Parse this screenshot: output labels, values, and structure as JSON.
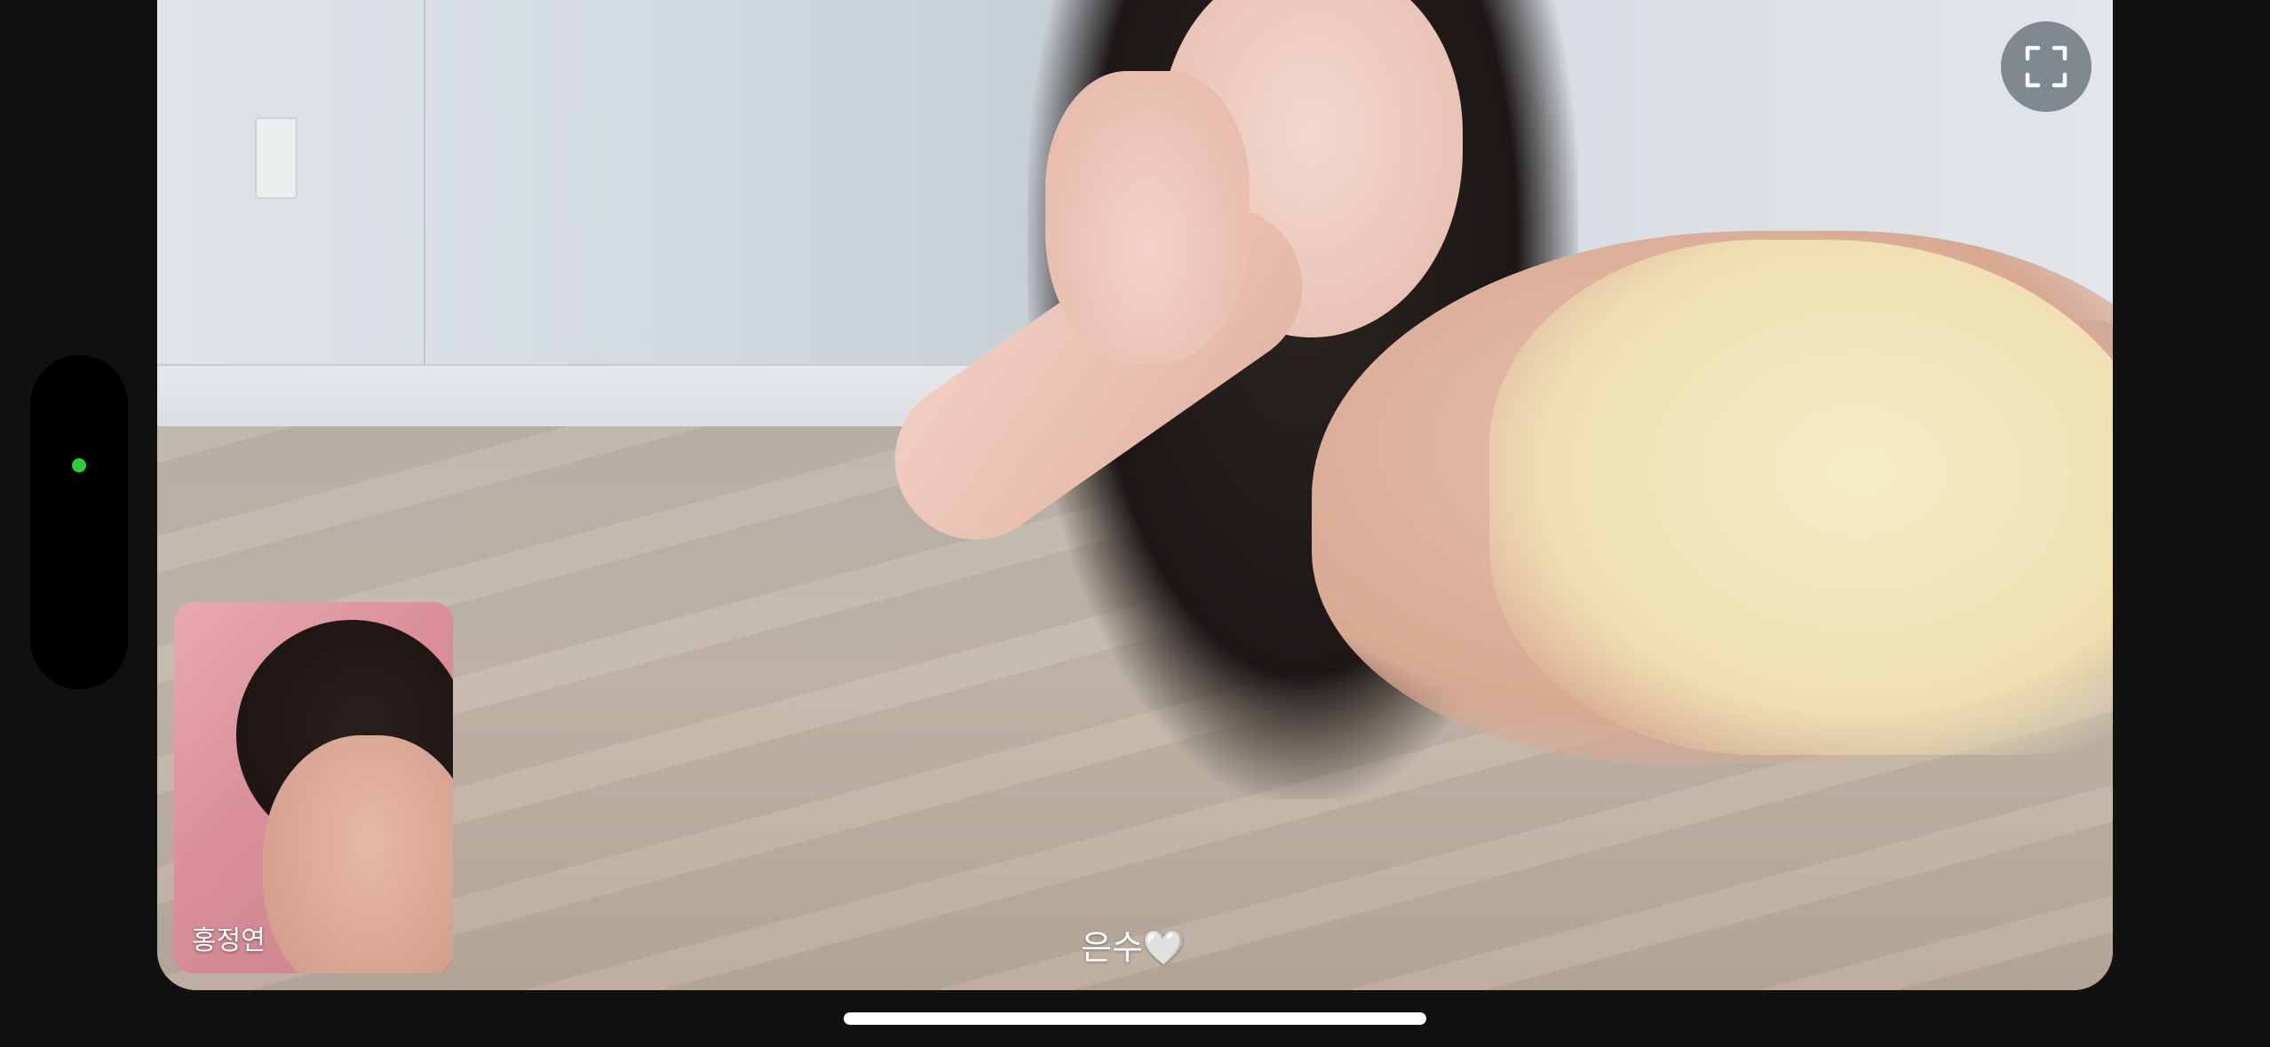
{
  "call": {
    "remote_name": "은수🤍",
    "self_name": "홍정연"
  },
  "status": {
    "indicator_color": "#2ecc40"
  },
  "icons": {
    "expand": "fullscreen-icon"
  }
}
